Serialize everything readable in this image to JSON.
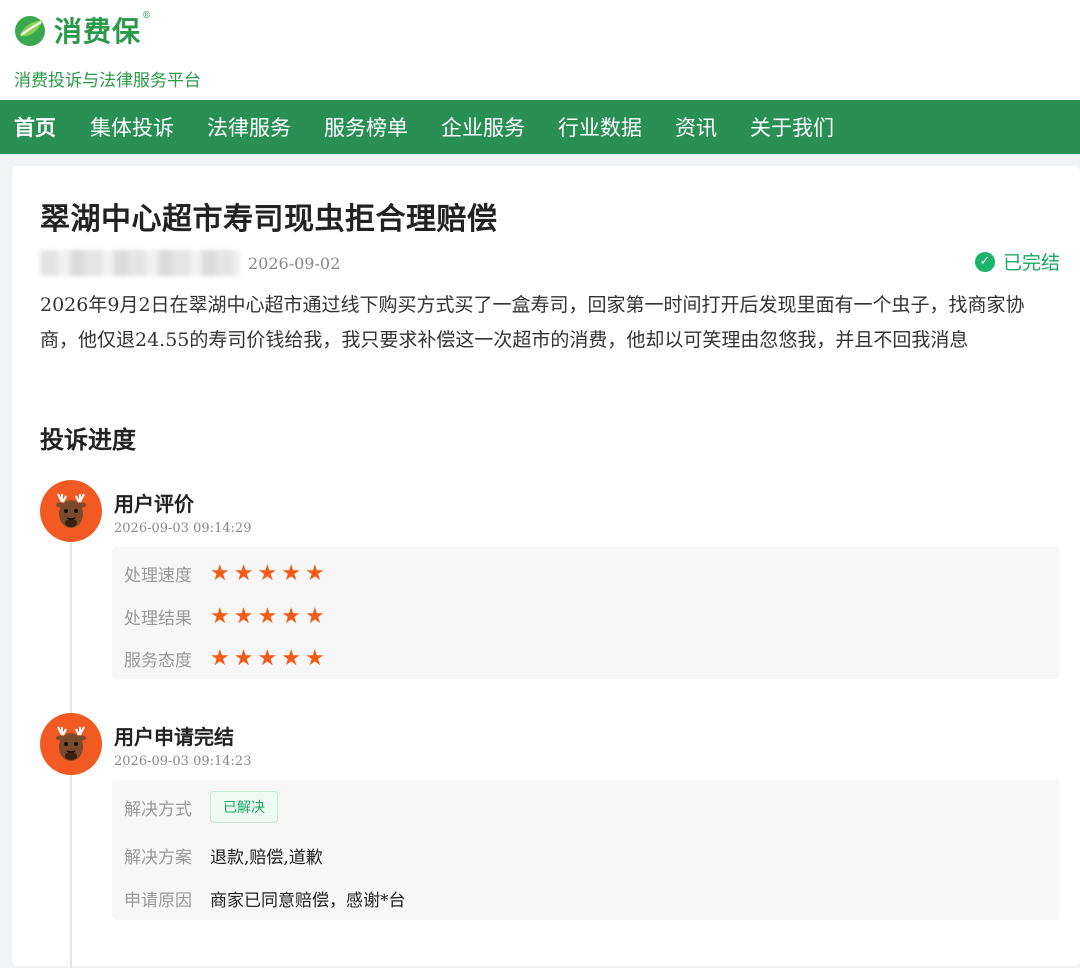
{
  "brand": {
    "name": "消费保",
    "reg": "®",
    "slogan": "消费投诉与法律服务平台"
  },
  "nav": {
    "items": [
      "首页",
      "集体投诉",
      "法律服务",
      "服务榜单",
      "企业服务",
      "行业数据",
      "资讯",
      "关于我们"
    ]
  },
  "complaint": {
    "title": "翠湖中心超市寿司现虫拒合理赔偿",
    "date": "2026-09-02",
    "status": "已完结",
    "status_icon": "check-circle-icon",
    "description": "2026年9月2日在翠湖中心超市通过线下购买方式买了一盒寿司，回家第一时间打开后发现里面有一个虫子，找商家协商，他仅退24.55的寿司价钱给我，我只要求补偿这一次超市的消费，他却以可笑理由忽悠我，并且不回我消息"
  },
  "progress": {
    "title": "投诉进度",
    "events": [
      {
        "title": "用户评价",
        "time": "2026-09-03 09:14:29",
        "ratings": [
          {
            "label": "处理速度",
            "stars": 5
          },
          {
            "label": "处理结果",
            "stars": 5
          },
          {
            "label": "服务态度",
            "stars": 5
          }
        ]
      },
      {
        "title": "用户申请完结",
        "time": "2026-09-03 09:14:23",
        "resolution_label": "解决方式",
        "resolution_tag": "已解决",
        "plan_label": "解决方案",
        "plan_value": "退款,赔偿,道歉",
        "reason_label": "申请原因",
        "reason_value": "商家已同意赔偿，感谢*台"
      }
    ]
  },
  "colors": {
    "brand_green": "#2a9a4a",
    "nav_green": "#2a8f55",
    "star_orange": "#f25c18",
    "status_green": "#19a862"
  }
}
